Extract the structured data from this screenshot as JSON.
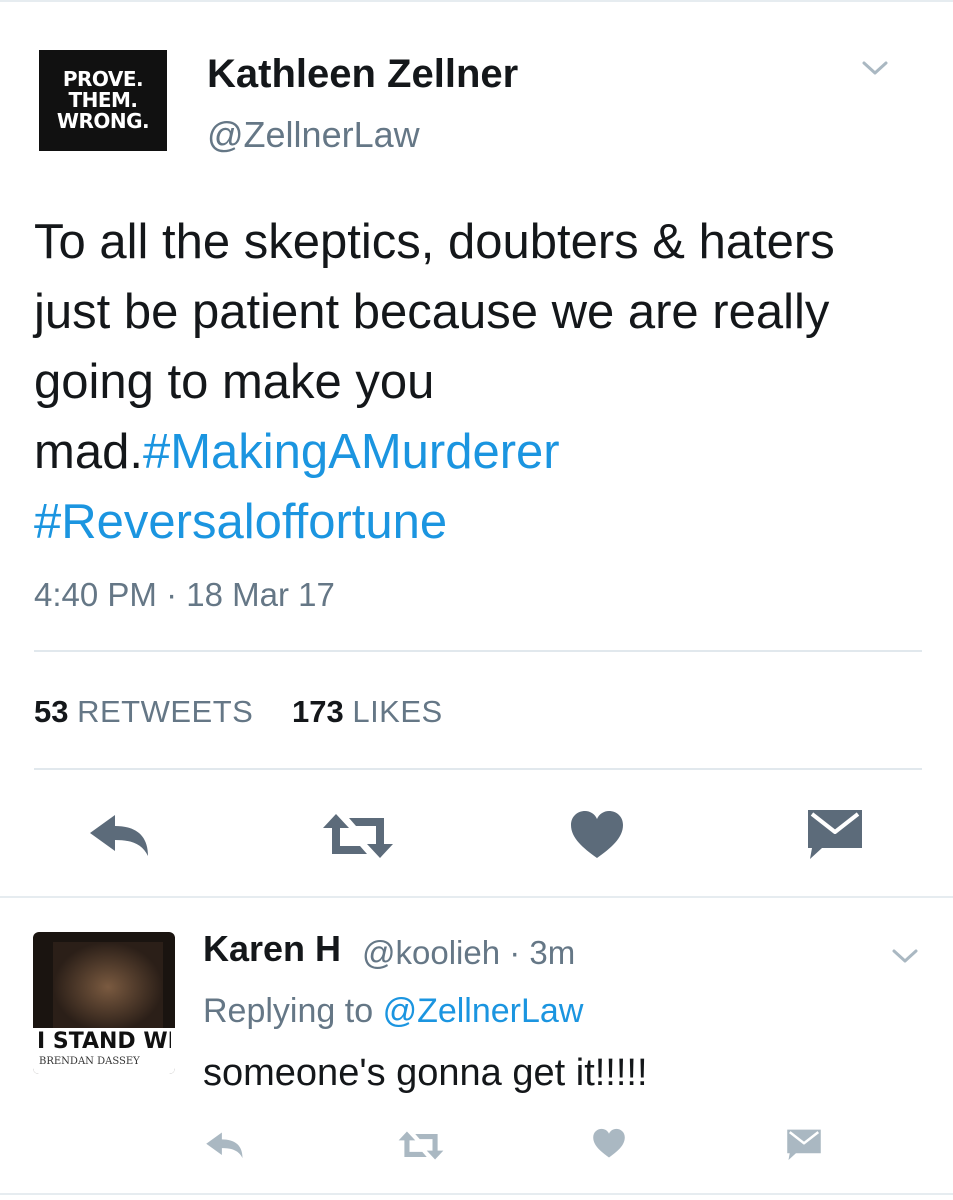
{
  "tweet": {
    "avatar_text": [
      "PROVE.",
      "THEM.",
      "WRONG."
    ],
    "display_name": "Kathleen Zellner",
    "handle": "@ZellnerLaw",
    "text_plain": "To all the skeptics, doubters & haters just be patient because we are  really going to make you mad.",
    "hashtag_1": "#MakingAMurderer",
    "hashtag_2": "#Reversaloffortune",
    "timestamp": "4:40 PM · 18 Mar 17",
    "retweet_count": "53",
    "retweet_label": "RETWEETS",
    "like_count": "173",
    "like_label": "LIKES"
  },
  "reply": {
    "avatar_text": "I STAND WITH",
    "avatar_subtext": "BRENDAN DASSEY",
    "display_name": "Karen H",
    "meta": "@koolieh · 3m",
    "replying_prefix": "Replying to",
    "replying_mention": "@ZellnerLaw",
    "text": "someone's gonna get it!!!!!"
  },
  "icons": {
    "reply": "reply-icon",
    "retweet": "retweet-icon",
    "like": "heart-icon",
    "dm": "envelope-icon",
    "more": "chevron-down-icon"
  },
  "colors": {
    "link": "#1b95e0",
    "secondary_text": "#657786",
    "icon_main": "#5c6b7a",
    "icon_reply": "#aab8c2"
  }
}
